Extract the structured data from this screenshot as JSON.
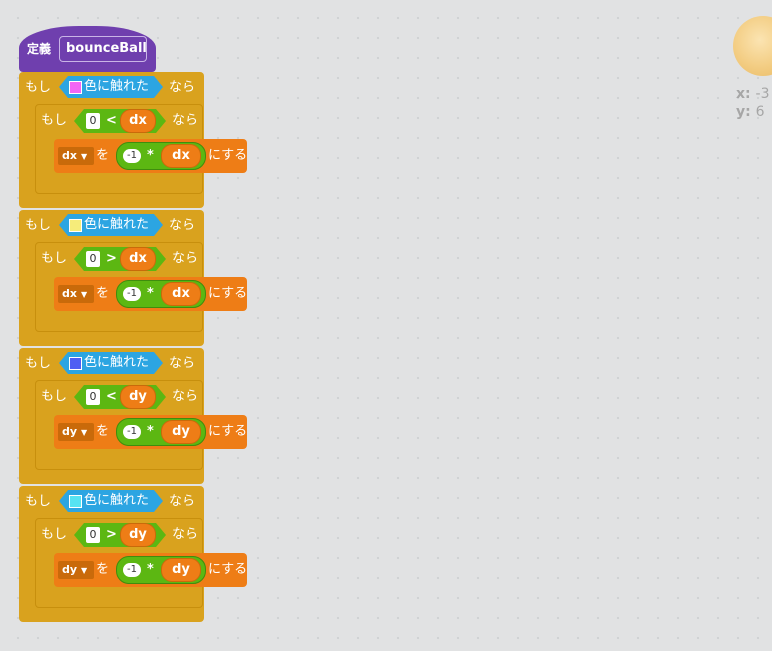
{
  "define": {
    "keyword": "定義",
    "name": "bounceBall"
  },
  "labels": {
    "if": "もし",
    "then": "なら",
    "touching": "色に触れた",
    "set_to": "を",
    "set_verb": "にする",
    "times": "*"
  },
  "blocks": [
    {
      "color": "#f266f5",
      "cmp_left": "0",
      "op": "<",
      "var": "dx",
      "target": "dx",
      "factor": "-1"
    },
    {
      "color": "#f6ec7a",
      "cmp_left": "0",
      "op": ">",
      "var": "dx",
      "target": "dx",
      "factor": "-1"
    },
    {
      "color": "#4e5ef3",
      "cmp_left": "0",
      "op": "<",
      "var": "dy",
      "target": "dy",
      "factor": "-1"
    },
    {
      "color": "#57e3f2",
      "cmp_left": "0",
      "op": ">",
      "var": "dy",
      "target": "dy",
      "factor": "-1"
    }
  ],
  "sprite_info": {
    "x_label": "x:",
    "x_value": "-3",
    "y_label": "y:",
    "y_value": "6"
  }
}
